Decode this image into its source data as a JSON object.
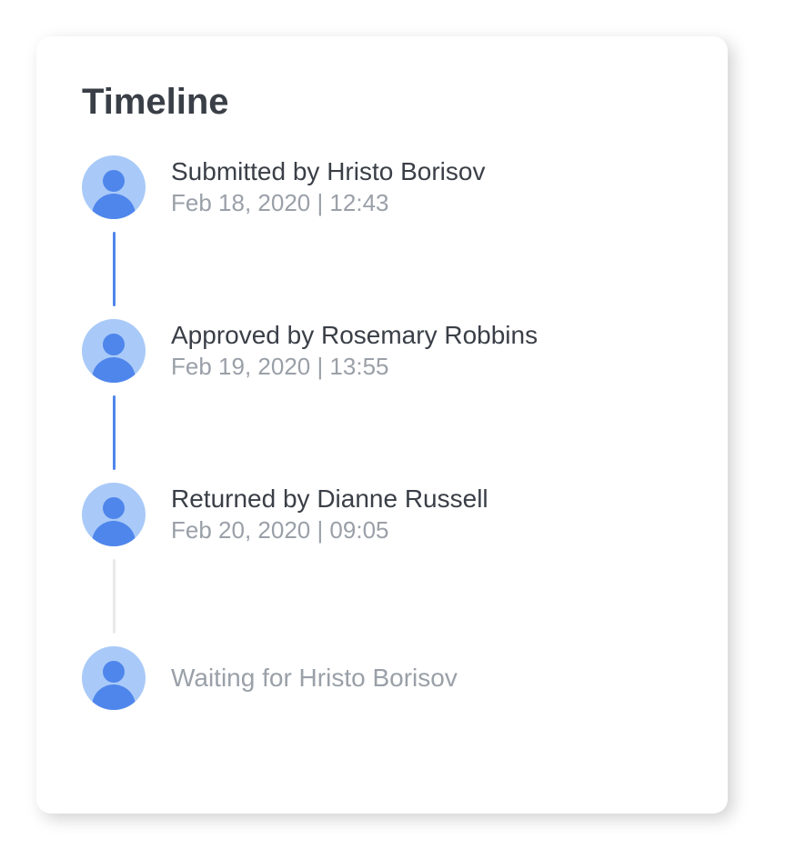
{
  "card": {
    "title": "Timeline",
    "items": [
      {
        "title": "Submitted by Hristo Borisov",
        "timestamp": "Feb 18, 2020 | 12:43",
        "connector": "active"
      },
      {
        "title": "Approved by Rosemary Robbins",
        "timestamp": "Feb 19, 2020 | 13:55",
        "connector": "active"
      },
      {
        "title": "Returned by Dianne Russell",
        "timestamp": "Feb 20, 2020 | 09:05",
        "connector": "faded"
      },
      {
        "title": "Waiting for Hristo Borisov",
        "timestamp": "",
        "muted": true
      }
    ]
  }
}
